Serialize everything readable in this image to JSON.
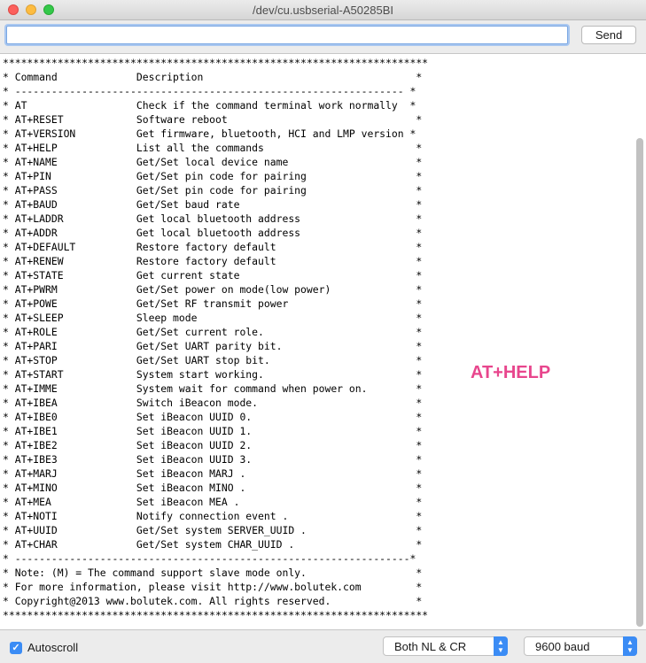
{
  "window": {
    "title": "/dev/cu.usbserial-A50285BI"
  },
  "toolbar": {
    "input_value": "",
    "send_label": "Send"
  },
  "console": {
    "lines": [
      "**********************************************************************",
      "* Command             Description                                   *",
      "* ---------------------------------------------------------------- *",
      "* AT                  Check if the command terminal work normally  *",
      "* AT+RESET            Software reboot                               *",
      "* AT+VERSION          Get firmware, bluetooth, HCI and LMP version *",
      "* AT+HELP             List all the commands                         *",
      "* AT+NAME             Get/Set local device name                     *",
      "* AT+PIN              Get/Set pin code for pairing                  *",
      "* AT+PASS             Get/Set pin code for pairing                  *",
      "* AT+BAUD             Get/Set baud rate                             *",
      "* AT+LADDR            Get local bluetooth address                   *",
      "* AT+ADDR             Get local bluetooth address                   *",
      "* AT+DEFAULT          Restore factory default                       *",
      "* AT+RENEW            Restore factory default                       *",
      "* AT+STATE            Get current state                             *",
      "* AT+PWRM             Get/Set power on mode(low power)              *",
      "* AT+POWE             Get/Set RF transmit power                     *",
      "* AT+SLEEP            Sleep mode                                    *",
      "* AT+ROLE             Get/Set current role.                         *",
      "* AT+PARI             Get/Set UART parity bit.                      *",
      "* AT+STOP             Get/Set UART stop bit.                        *",
      "* AT+START            System start working.                         *",
      "* AT+IMME             System wait for command when power on.        *",
      "* AT+IBEA             Switch iBeacon mode.                          *",
      "* AT+IBE0             Set iBeacon UUID 0.                           *",
      "* AT+IBE1             Set iBeacon UUID 1.                           *",
      "* AT+IBE2             Set iBeacon UUID 2.                           *",
      "* AT+IBE3             Set iBeacon UUID 3.                           *",
      "* AT+MARJ             Set iBeacon MARJ .                            *",
      "* AT+MINO             Set iBeacon MINO .                            *",
      "* AT+MEA              Set iBeacon MEA .                             *",
      "* AT+NOTI             Notify connection event .                     *",
      "* AT+UUID             Get/Set system SERVER_UUID .                  *",
      "* AT+CHAR             Get/Set system CHAR_UUID .                    *",
      "* -----------------------------------------------------------------*",
      "* Note: (M) = The command support slave mode only.                  *",
      "* For more information, please visit http://www.bolutek.com         *",
      "* Copyright@2013 www.bolutek.com. All rights reserved.              *",
      "**********************************************************************"
    ]
  },
  "annotation": {
    "text": "AT+HELP",
    "color": "#e8468d"
  },
  "footer": {
    "autoscroll_label": "Autoscroll",
    "autoscroll_checked": true,
    "line_ending": "Both NL & CR",
    "baud_rate": "9600 baud"
  },
  "colors": {
    "accent": "#3b8cf5"
  }
}
